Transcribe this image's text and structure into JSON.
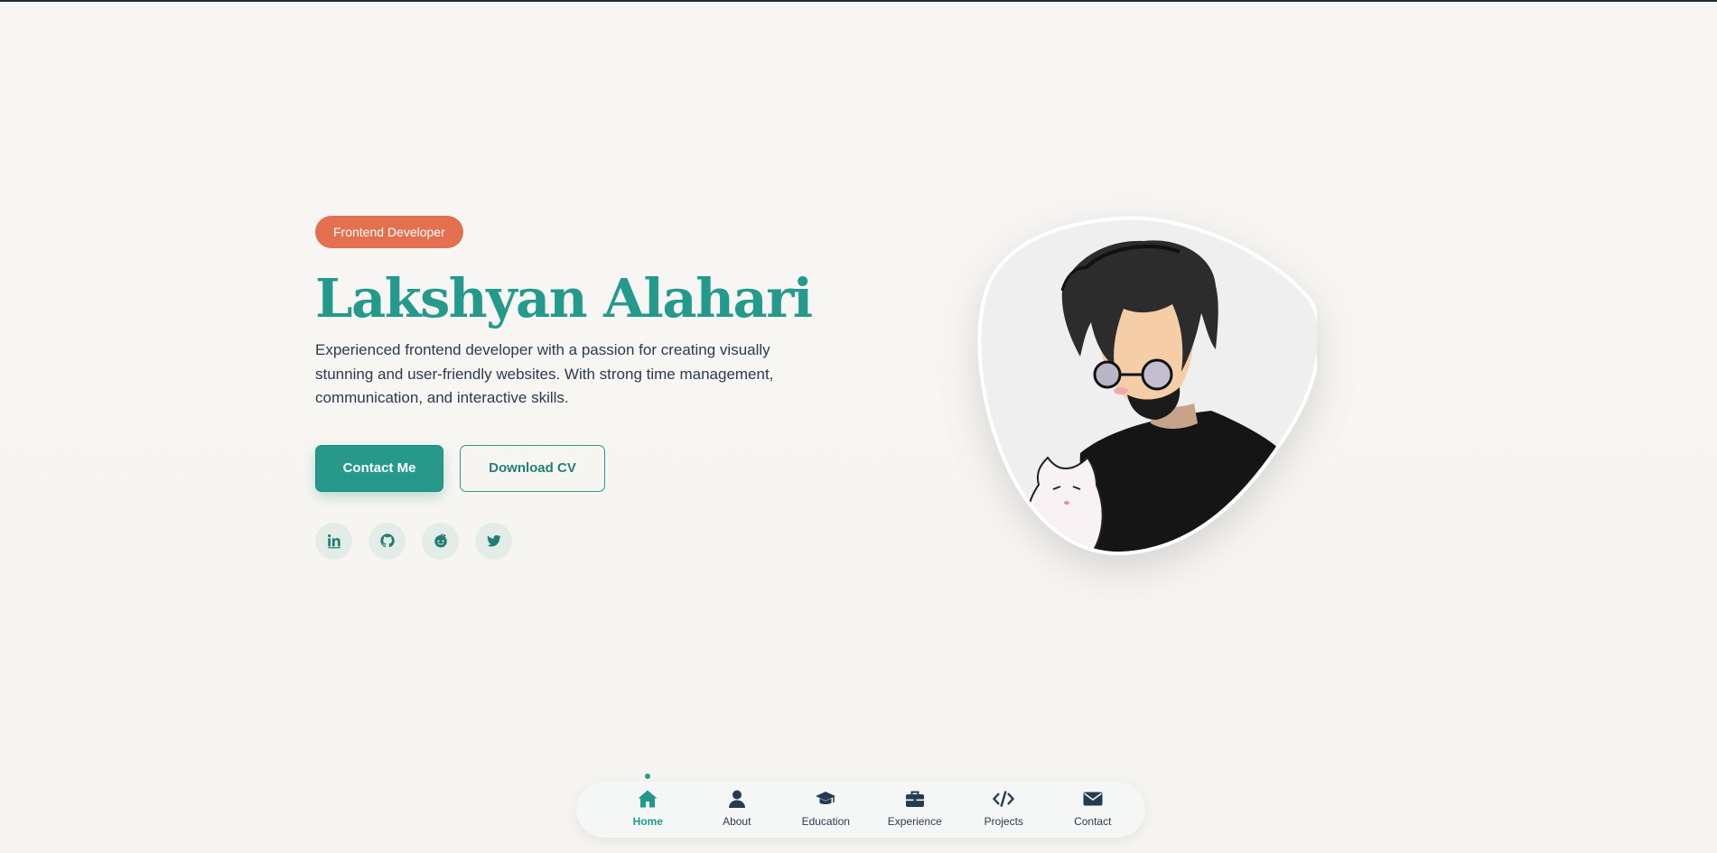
{
  "hero": {
    "badge": "Frontend Developer",
    "name": "Lakshyan Alahari",
    "bio": "Experienced frontend developer with a passion for creating visually stunning and user-friendly websites. With strong time management, communication, and interactive skills.",
    "primary_button": "Contact Me",
    "secondary_button": "Download CV"
  },
  "socials": [
    {
      "icon": "linkedin-icon"
    },
    {
      "icon": "github-icon"
    },
    {
      "icon": "reddit-icon"
    },
    {
      "icon": "twitter-icon"
    }
  ],
  "avatar": {
    "icon": "avatar-illustration"
  },
  "nav": {
    "active": "Home",
    "items": [
      {
        "label": "Home",
        "icon": "home-icon"
      },
      {
        "label": "About",
        "icon": "user-icon"
      },
      {
        "label": "Education",
        "icon": "graduation-cap-icon"
      },
      {
        "label": "Experience",
        "icon": "briefcase-icon"
      },
      {
        "label": "Projects",
        "icon": "code-icon"
      },
      {
        "label": "Contact",
        "icon": "envelope-icon"
      }
    ]
  },
  "colors": {
    "accent": "#27998b",
    "badge": "#e3704f",
    "text": "#2c3a4f",
    "background": "#f7f6f3"
  }
}
